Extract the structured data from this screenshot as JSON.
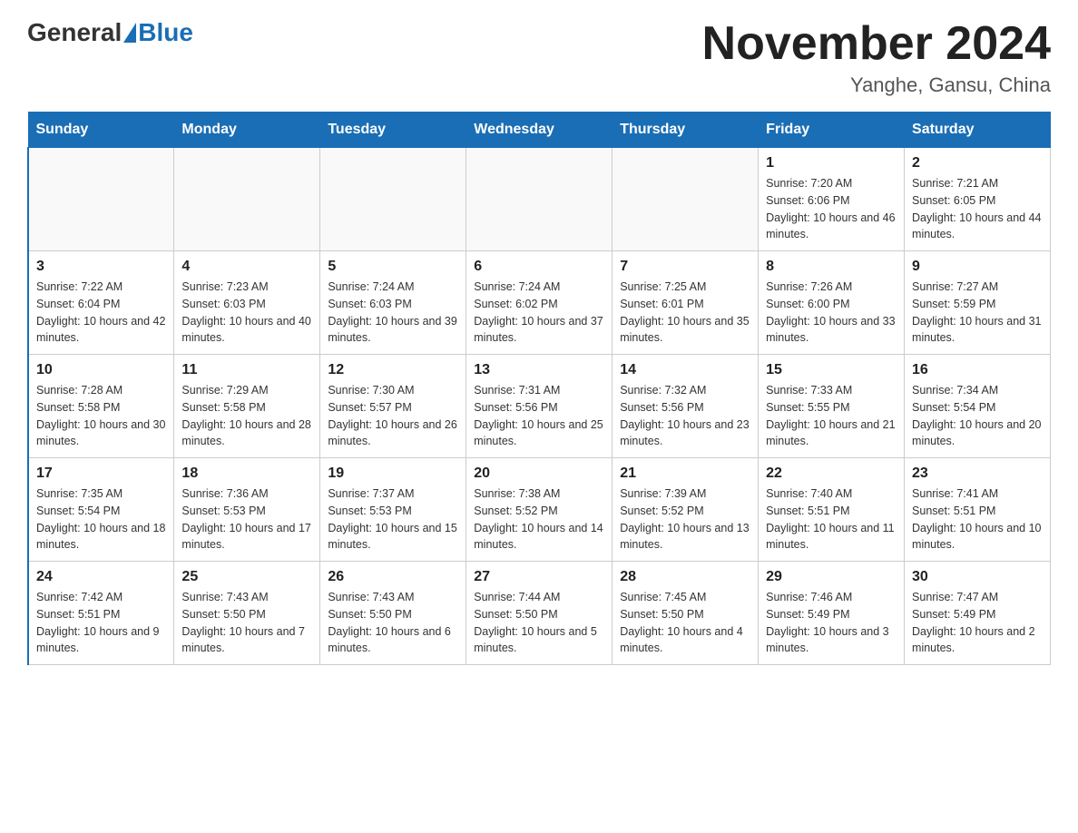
{
  "header": {
    "logo_general": "General",
    "logo_blue": "Blue",
    "month_year": "November 2024",
    "location": "Yanghe, Gansu, China"
  },
  "weekdays": [
    "Sunday",
    "Monday",
    "Tuesday",
    "Wednesday",
    "Thursday",
    "Friday",
    "Saturday"
  ],
  "weeks": [
    [
      {
        "day": "",
        "sunrise": "",
        "sunset": "",
        "daylight": ""
      },
      {
        "day": "",
        "sunrise": "",
        "sunset": "",
        "daylight": ""
      },
      {
        "day": "",
        "sunrise": "",
        "sunset": "",
        "daylight": ""
      },
      {
        "day": "",
        "sunrise": "",
        "sunset": "",
        "daylight": ""
      },
      {
        "day": "",
        "sunrise": "",
        "sunset": "",
        "daylight": ""
      },
      {
        "day": "1",
        "sunrise": "Sunrise: 7:20 AM",
        "sunset": "Sunset: 6:06 PM",
        "daylight": "Daylight: 10 hours and 46 minutes."
      },
      {
        "day": "2",
        "sunrise": "Sunrise: 7:21 AM",
        "sunset": "Sunset: 6:05 PM",
        "daylight": "Daylight: 10 hours and 44 minutes."
      }
    ],
    [
      {
        "day": "3",
        "sunrise": "Sunrise: 7:22 AM",
        "sunset": "Sunset: 6:04 PM",
        "daylight": "Daylight: 10 hours and 42 minutes."
      },
      {
        "day": "4",
        "sunrise": "Sunrise: 7:23 AM",
        "sunset": "Sunset: 6:03 PM",
        "daylight": "Daylight: 10 hours and 40 minutes."
      },
      {
        "day": "5",
        "sunrise": "Sunrise: 7:24 AM",
        "sunset": "Sunset: 6:03 PM",
        "daylight": "Daylight: 10 hours and 39 minutes."
      },
      {
        "day": "6",
        "sunrise": "Sunrise: 7:24 AM",
        "sunset": "Sunset: 6:02 PM",
        "daylight": "Daylight: 10 hours and 37 minutes."
      },
      {
        "day": "7",
        "sunrise": "Sunrise: 7:25 AM",
        "sunset": "Sunset: 6:01 PM",
        "daylight": "Daylight: 10 hours and 35 minutes."
      },
      {
        "day": "8",
        "sunrise": "Sunrise: 7:26 AM",
        "sunset": "Sunset: 6:00 PM",
        "daylight": "Daylight: 10 hours and 33 minutes."
      },
      {
        "day": "9",
        "sunrise": "Sunrise: 7:27 AM",
        "sunset": "Sunset: 5:59 PM",
        "daylight": "Daylight: 10 hours and 31 minutes."
      }
    ],
    [
      {
        "day": "10",
        "sunrise": "Sunrise: 7:28 AM",
        "sunset": "Sunset: 5:58 PM",
        "daylight": "Daylight: 10 hours and 30 minutes."
      },
      {
        "day": "11",
        "sunrise": "Sunrise: 7:29 AM",
        "sunset": "Sunset: 5:58 PM",
        "daylight": "Daylight: 10 hours and 28 minutes."
      },
      {
        "day": "12",
        "sunrise": "Sunrise: 7:30 AM",
        "sunset": "Sunset: 5:57 PM",
        "daylight": "Daylight: 10 hours and 26 minutes."
      },
      {
        "day": "13",
        "sunrise": "Sunrise: 7:31 AM",
        "sunset": "Sunset: 5:56 PM",
        "daylight": "Daylight: 10 hours and 25 minutes."
      },
      {
        "day": "14",
        "sunrise": "Sunrise: 7:32 AM",
        "sunset": "Sunset: 5:56 PM",
        "daylight": "Daylight: 10 hours and 23 minutes."
      },
      {
        "day": "15",
        "sunrise": "Sunrise: 7:33 AM",
        "sunset": "Sunset: 5:55 PM",
        "daylight": "Daylight: 10 hours and 21 minutes."
      },
      {
        "day": "16",
        "sunrise": "Sunrise: 7:34 AM",
        "sunset": "Sunset: 5:54 PM",
        "daylight": "Daylight: 10 hours and 20 minutes."
      }
    ],
    [
      {
        "day": "17",
        "sunrise": "Sunrise: 7:35 AM",
        "sunset": "Sunset: 5:54 PM",
        "daylight": "Daylight: 10 hours and 18 minutes."
      },
      {
        "day": "18",
        "sunrise": "Sunrise: 7:36 AM",
        "sunset": "Sunset: 5:53 PM",
        "daylight": "Daylight: 10 hours and 17 minutes."
      },
      {
        "day": "19",
        "sunrise": "Sunrise: 7:37 AM",
        "sunset": "Sunset: 5:53 PM",
        "daylight": "Daylight: 10 hours and 15 minutes."
      },
      {
        "day": "20",
        "sunrise": "Sunrise: 7:38 AM",
        "sunset": "Sunset: 5:52 PM",
        "daylight": "Daylight: 10 hours and 14 minutes."
      },
      {
        "day": "21",
        "sunrise": "Sunrise: 7:39 AM",
        "sunset": "Sunset: 5:52 PM",
        "daylight": "Daylight: 10 hours and 13 minutes."
      },
      {
        "day": "22",
        "sunrise": "Sunrise: 7:40 AM",
        "sunset": "Sunset: 5:51 PM",
        "daylight": "Daylight: 10 hours and 11 minutes."
      },
      {
        "day": "23",
        "sunrise": "Sunrise: 7:41 AM",
        "sunset": "Sunset: 5:51 PM",
        "daylight": "Daylight: 10 hours and 10 minutes."
      }
    ],
    [
      {
        "day": "24",
        "sunrise": "Sunrise: 7:42 AM",
        "sunset": "Sunset: 5:51 PM",
        "daylight": "Daylight: 10 hours and 9 minutes."
      },
      {
        "day": "25",
        "sunrise": "Sunrise: 7:43 AM",
        "sunset": "Sunset: 5:50 PM",
        "daylight": "Daylight: 10 hours and 7 minutes."
      },
      {
        "day": "26",
        "sunrise": "Sunrise: 7:43 AM",
        "sunset": "Sunset: 5:50 PM",
        "daylight": "Daylight: 10 hours and 6 minutes."
      },
      {
        "day": "27",
        "sunrise": "Sunrise: 7:44 AM",
        "sunset": "Sunset: 5:50 PM",
        "daylight": "Daylight: 10 hours and 5 minutes."
      },
      {
        "day": "28",
        "sunrise": "Sunrise: 7:45 AM",
        "sunset": "Sunset: 5:50 PM",
        "daylight": "Daylight: 10 hours and 4 minutes."
      },
      {
        "day": "29",
        "sunrise": "Sunrise: 7:46 AM",
        "sunset": "Sunset: 5:49 PM",
        "daylight": "Daylight: 10 hours and 3 minutes."
      },
      {
        "day": "30",
        "sunrise": "Sunrise: 7:47 AM",
        "sunset": "Sunset: 5:49 PM",
        "daylight": "Daylight: 10 hours and 2 minutes."
      }
    ]
  ]
}
